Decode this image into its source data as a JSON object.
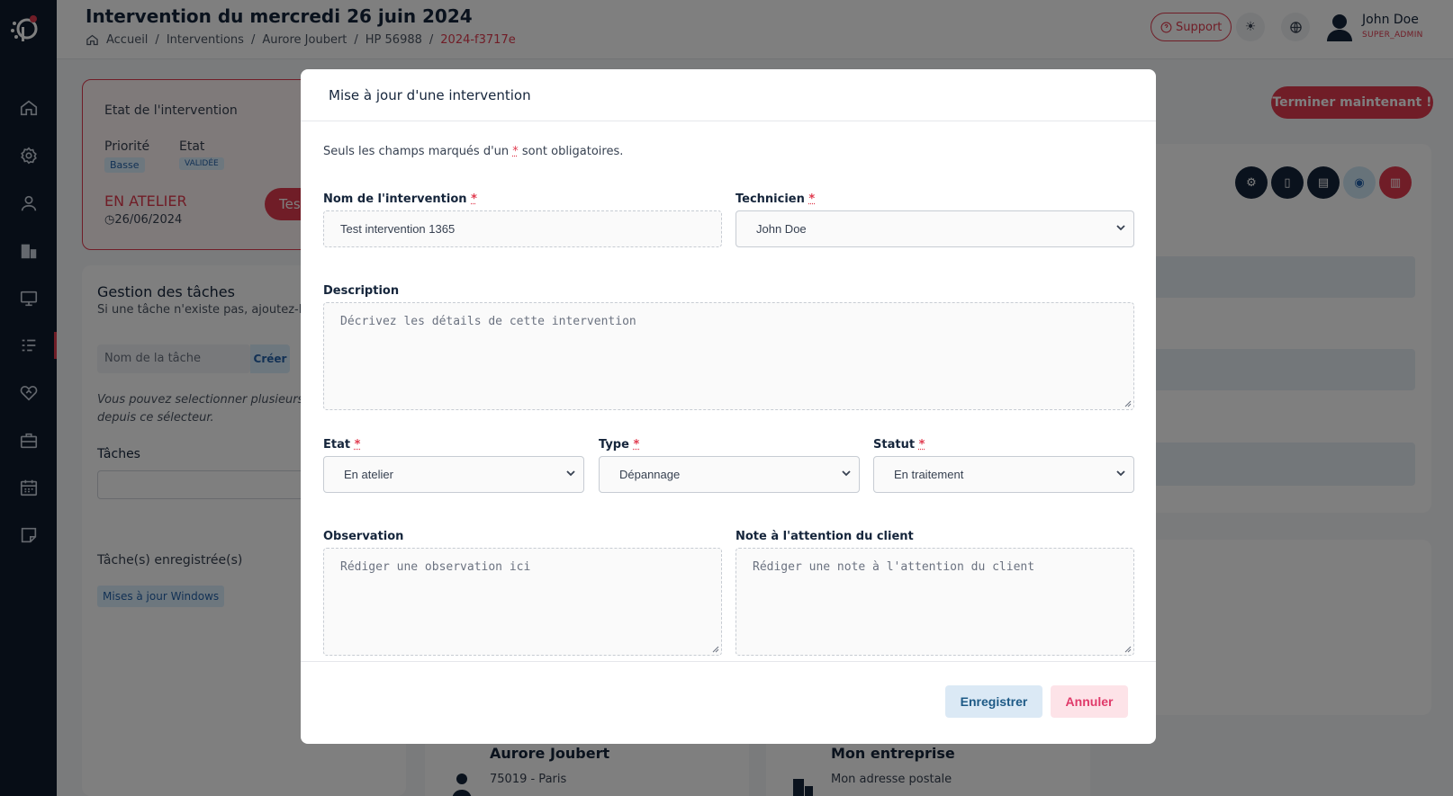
{
  "header": {
    "title": "Intervention du mercredi 26 juin 2024",
    "breadcrumb": [
      "Accueil",
      "Interventions",
      "Aurore Joubert",
      "HP 56988",
      "2024-f3717e"
    ],
    "support_label": "Support",
    "user_name": "John Doe",
    "user_role": "SUPER_ADMIN"
  },
  "sidebar": {
    "items": [
      "home-icon",
      "settings-icon",
      "user-icon",
      "building-icon",
      "monitor-icon",
      "list-icon",
      "heart-handshake-icon",
      "briefcase-icon",
      "calendar-icon",
      "note-icon"
    ],
    "active_index": 5
  },
  "state_card": {
    "title": "Etat de l'intervention",
    "priority_label": "Priorité",
    "priority_value": "Basse",
    "state_label": "Etat",
    "state_value": "VALIDÉE",
    "status": "EN ATELIER",
    "date": "26/06/2024",
    "action_partial": "Tes"
  },
  "tasks": {
    "title": "Gestion des tâches",
    "subtitle": "Si une tâche n'existe pas, ajoutez-la c",
    "input_placeholder": "Nom de la tâche",
    "create_label": "Créer",
    "help_line1": "Vous pouvez selectionner plusieurs tâ",
    "help_line2": "depuis ce sélecteur.",
    "tasks_label": "Tâches",
    "saved_label": "Tâche(s) enregistrée(s)",
    "saved_item": "Mises à jour Windows"
  },
  "right": {
    "finish_label": "Terminer maintenant !"
  },
  "bottom": {
    "client_name": "Aurore Joubert",
    "client_city": "75019 - Paris",
    "company_name": "Mon entreprise",
    "company_address": "Mon adresse postale"
  },
  "modal": {
    "title": "Mise à jour d'une intervention",
    "required_note_before": "Seuls les champs marqués d'un ",
    "required_star": "*",
    "required_note_after": " sont obligatoires.",
    "name_label": "Nom de l'intervention",
    "name_value": "Test intervention 1365",
    "technician_label": "Technicien",
    "technician_value": "John Doe",
    "description_label": "Description",
    "description_placeholder": "Décrivez les détails de cette intervention",
    "etat_label": "Etat",
    "etat_value": "En atelier",
    "type_label": "Type",
    "type_value": "Dépannage",
    "statut_label": "Statut",
    "statut_value": "En traitement",
    "observation_label": "Observation",
    "observation_placeholder": "Rédiger une observation ici",
    "note_label": "Note à l'attention du client",
    "note_placeholder": "Rédiger une note à l'attention du client",
    "save_label": "Enregistrer",
    "cancel_label": "Annuler"
  }
}
